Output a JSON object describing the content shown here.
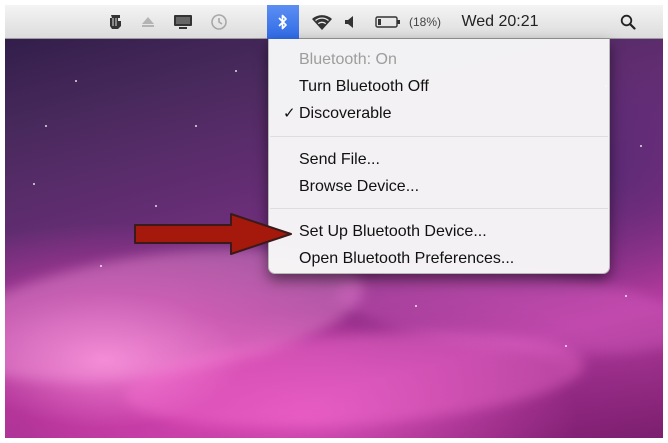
{
  "menubar": {
    "battery_percent": "(18%)",
    "clock": "Wed 20:21",
    "icons": [
      "script-icon",
      "eject-icon",
      "display-icon",
      "time-machine-icon",
      "bluetooth-icon",
      "wifi-icon",
      "volume-icon",
      "battery-icon",
      "spotlight-icon"
    ]
  },
  "bluetooth_menu": {
    "status": "Bluetooth: On",
    "turn_off": "Turn Bluetooth Off",
    "discoverable": "Discoverable",
    "discoverable_check": "✓",
    "send_file": "Send File...",
    "browse_device": "Browse Device...",
    "setup_device": "Set Up Bluetooth Device...",
    "open_prefs": "Open Bluetooth Preferences..."
  },
  "colors": {
    "highlight": "#3470e8",
    "arrow_fill": "#a5180c",
    "arrow_stroke": "#3a1a1a"
  }
}
